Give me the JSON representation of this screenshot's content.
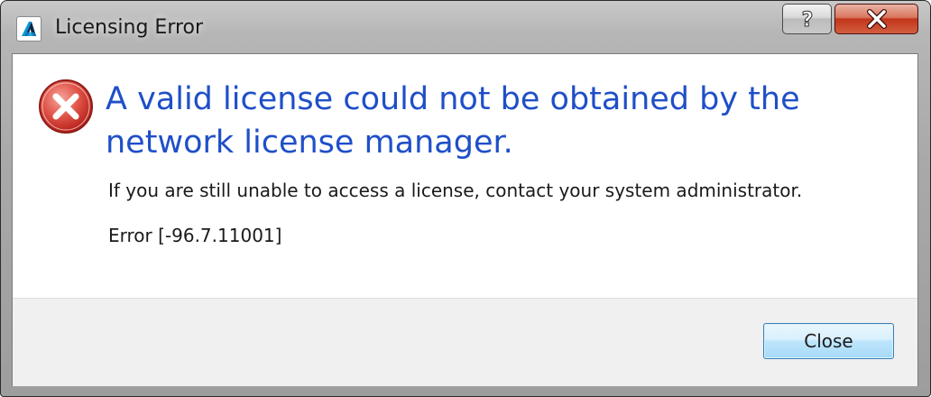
{
  "window": {
    "title": "Licensing Error",
    "app_icon": "autodesk-logo-icon",
    "help_icon": "question-mark-icon",
    "close_icon": "close-x-icon"
  },
  "content": {
    "status_icon": "error-icon",
    "heading": "A valid license could not be obtained by the network license manager.",
    "message": "If you are still unable to access a license, contact your system administrator.",
    "error_code": "Error [-96.7.11001]"
  },
  "footer": {
    "close_label": "Close"
  },
  "colors": {
    "heading": "#1f4fc8",
    "error_red": "#d9322b",
    "titlebar_close_red": "#c2351b",
    "button_border": "#3c7fb1"
  }
}
